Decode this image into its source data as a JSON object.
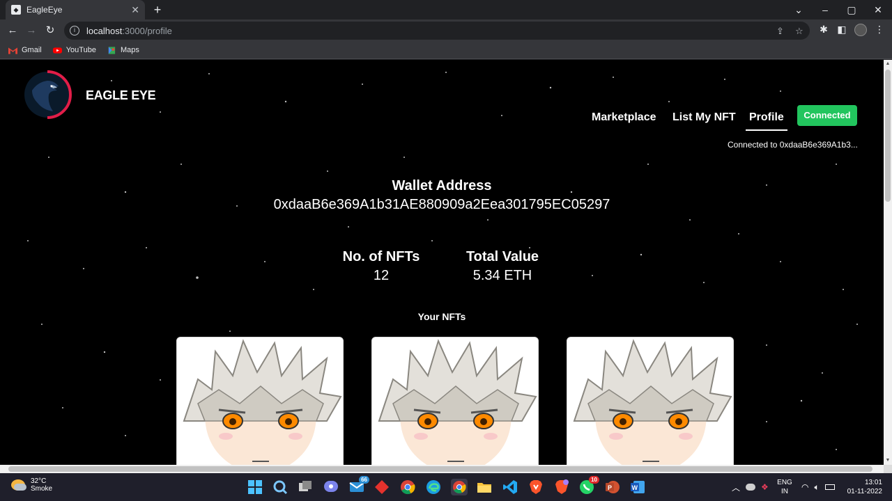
{
  "browser": {
    "tab_title": "EagleEye",
    "tab_close": "✕",
    "new_tab": "+",
    "url_host": "localhost",
    "url_path": ":3000/profile",
    "bookmarks": [
      "Gmail",
      "YouTube",
      "Maps"
    ]
  },
  "site": {
    "brand": "EAGLE EYE",
    "nav": [
      "Marketplace",
      "List My NFT",
      "Profile"
    ],
    "connect_button": "Connected",
    "connected_text": "Connected to 0xdaaB6e369A1b3..."
  },
  "profile": {
    "wallet_label": "Wallet Address",
    "wallet_address": "0xdaaB6e369A1b31AE880909a2Eea301795EC05297",
    "nft_count_label": "No. of NFTs",
    "nft_count": "12",
    "total_value_label": "Total Value",
    "total_value": "5.34 ETH",
    "your_nfts_label": "Your NFTs"
  },
  "taskbar": {
    "temperature": "32°C",
    "weather": "Smoke",
    "mail_badge": "66",
    "whatsapp_badge": "10",
    "language_top": "ENG",
    "language_bottom": "IN",
    "time": "13:01",
    "date": "01-11-2022"
  },
  "colors": {
    "connected_green": "#22c55e",
    "logo_red": "#e11d48",
    "logo_navy": "#1e3a5f"
  }
}
